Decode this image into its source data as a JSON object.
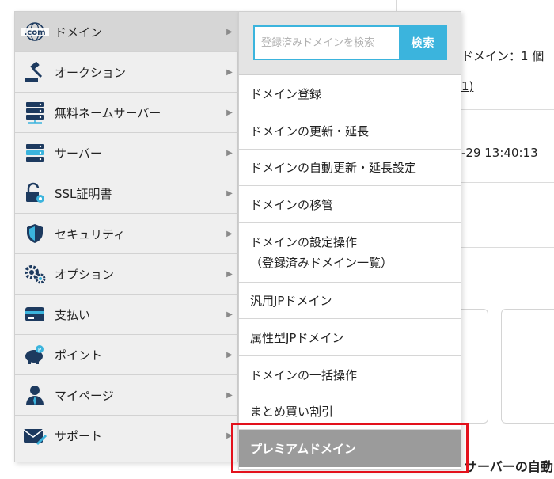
{
  "background": {
    "domain_count": "ドメイン：1 個",
    "link_fragment": "1)",
    "datetime_fragment": "-29 13:40:13",
    "bottom_fragment": "サーバーの自動"
  },
  "left_menu": {
    "items": [
      {
        "label": "ドメイン",
        "icon": "dotcom-icon"
      },
      {
        "label": "オークション",
        "icon": "gavel-icon"
      },
      {
        "label": "無料ネームサーバー",
        "icon": "name-server-icon"
      },
      {
        "label": "サーバー",
        "icon": "server-icon"
      },
      {
        "label": "SSL証明書",
        "icon": "ssl-lock-icon"
      },
      {
        "label": "セキュリティ",
        "icon": "shield-icon"
      },
      {
        "label": "オプション",
        "icon": "gears-icon"
      },
      {
        "label": "支払い",
        "icon": "wallet-icon"
      },
      {
        "label": "ポイント",
        "icon": "piggy-bank-icon"
      },
      {
        "label": "マイページ",
        "icon": "user-icon"
      },
      {
        "label": "サポート",
        "icon": "mail-icon"
      }
    ]
  },
  "sub_menu": {
    "search": {
      "placeholder": "登録済みドメインを検索",
      "button_label": "検索"
    },
    "items": [
      {
        "label": "ドメイン登録"
      },
      {
        "label": "ドメインの更新・延長"
      },
      {
        "label": "ドメインの自動更新・延長設定"
      },
      {
        "label": "ドメインの移管"
      },
      {
        "label": "ドメインの設定操作",
        "label2": "（登録済みドメイン一覧）"
      },
      {
        "label": "汎用JPドメイン"
      },
      {
        "label": "属性型JPドメイン"
      },
      {
        "label": "ドメインの一括操作"
      },
      {
        "label": "まとめ買い割引"
      },
      {
        "label": "プレミアムドメイン"
      }
    ]
  },
  "colors": {
    "accent": "#3bb4dd",
    "highlight": "#e3111c",
    "icon_blue": "#1d3a5f"
  }
}
